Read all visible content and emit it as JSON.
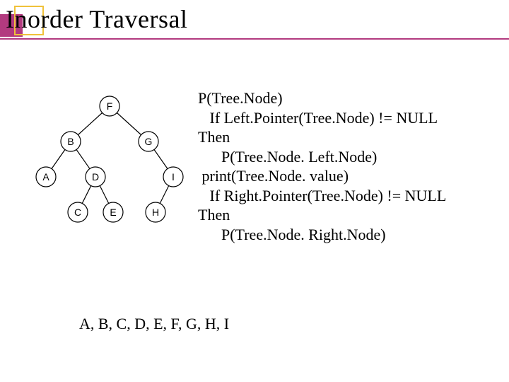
{
  "title": "Inorder Traversal",
  "tree": {
    "nodes": {
      "F": "F",
      "B": "B",
      "G": "G",
      "A": "A",
      "D": "D",
      "I": "I",
      "C": "C",
      "E": "E",
      "H": "H"
    }
  },
  "pseudocode": {
    "l1": "P(Tree.Node)",
    "l2": "   If Left.Pointer(Tree.Node) != NULL",
    "l3": "Then",
    "l4": "      P(Tree.Node. Left.Node)",
    "l5": " print(Tree.Node. value)",
    "l6": "   If Right.Pointer(Tree.Node) != NULL",
    "l7": "Then",
    "l8": "      P(Tree.Node. Right.Node)"
  },
  "result": "A, B, C, D, E, F, G, H, I"
}
